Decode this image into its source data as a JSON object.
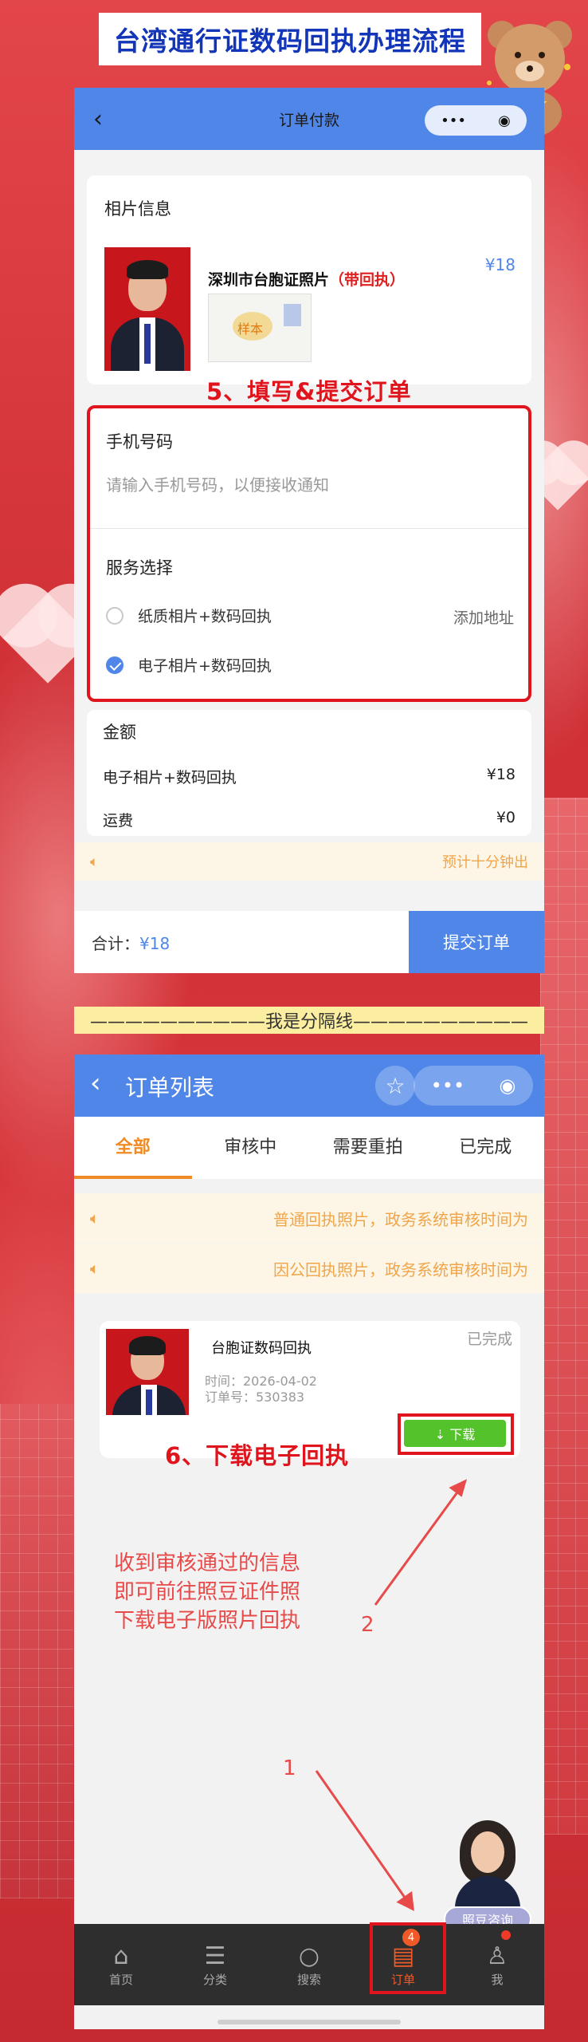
{
  "banner": {
    "title": "台湾通行证数码回执办理流程"
  },
  "order_pay": {
    "nav_title": "订单付款",
    "capsule_more": "•••",
    "photo_section_title": "相片信息",
    "product_name": "深圳市台胞证照片",
    "product_tag": "（带回执）",
    "product_price": "¥18",
    "receipt_stamp": "样本",
    "phone_label": "手机号码",
    "phone_placeholder": "请输入手机号码，以便接收通知",
    "service_label": "服务选择",
    "option_paper": "纸质相片+数码回执",
    "option_add_address": "添加地址",
    "option_digital": "电子相片+数码回执",
    "amount_label": "金额",
    "amount_item_label": "电子相片+数码回执",
    "amount_item_value": "¥18",
    "shipping_label": "运费",
    "shipping_value": "¥0",
    "eta_notice": "预计十分钟出",
    "total_label": "合计：",
    "total_value": "¥18",
    "submit_label": "提交订单"
  },
  "step5_label": "5、填写&提交订单",
  "separator_text": "——————————我是分隔线——————————",
  "order_list": {
    "nav_title": "订单列表",
    "tabs": [
      {
        "label": "全部"
      },
      {
        "label": "审核中"
      },
      {
        "label": "需要重拍"
      },
      {
        "label": "已完成"
      }
    ],
    "notices": [
      "普通回执照片，政务系统审核时间为",
      "因公回执照片，政务系统审核时间为"
    ],
    "order": {
      "title": "台胞证数码回执",
      "status": "已完成",
      "time": "时间：2026-04-02",
      "order_no": "订单号：530383",
      "download_label": "⇣ 下载"
    },
    "consult_label": "照豆咨询",
    "tabbar": [
      {
        "label": "首页",
        "icon": "home-icon",
        "glyph": "⌂"
      },
      {
        "label": "分类",
        "icon": "category-icon",
        "glyph": "☰"
      },
      {
        "label": "搜索",
        "icon": "search-icon",
        "glyph": "○"
      },
      {
        "label": "订单",
        "icon": "order-icon",
        "glyph": "▤",
        "badge": "4"
      },
      {
        "label": "我",
        "icon": "user-icon",
        "glyph": "♙"
      }
    ]
  },
  "step6_label": "6、下载电子回执",
  "hint_lines": [
    "收到审核通过的信息",
    "即可前往照豆证件照",
    "下载电子版照片回执"
  ],
  "arrow_numbers": [
    "1",
    "2"
  ],
  "colors": {
    "accent": "#4f86e8",
    "annotation_red": "#e0141c",
    "tab_active": "#f08a24",
    "download_green": "#53c22b"
  }
}
